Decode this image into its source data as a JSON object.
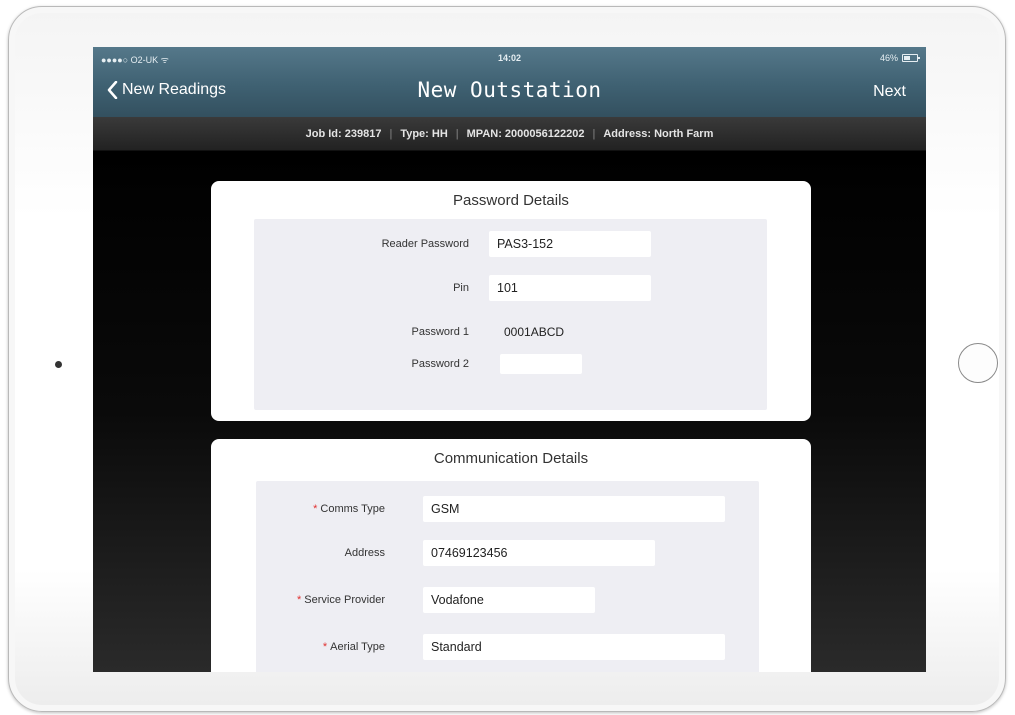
{
  "status_bar": {
    "carrier": "●●●●○ O2-UK ᯤ",
    "time": "14:02",
    "battery": "46%"
  },
  "nav": {
    "back_label": "New Readings",
    "title": "New Outstation",
    "next_label": "Next"
  },
  "job_info": {
    "job_id": "Job Id: 239817",
    "type": "Type: HH",
    "mpan": "MPAN: 2000056122202",
    "address": "Address: North Farm"
  },
  "password_details": {
    "title": "Password Details",
    "reader_password_label": "Reader Password",
    "reader_password_value": "PAS3-152",
    "pin_label": "Pin",
    "pin_value": "101",
    "password1_label": "Password 1",
    "password1_value": "0001ABCD",
    "password2_label": "Password 2",
    "password2_value": ""
  },
  "communication_details": {
    "title": "Communication Details",
    "required_marker": "*",
    "comms_type_label": "Comms Type",
    "comms_type_value": "GSM",
    "address_label": "Address",
    "address_value": "07469123456",
    "service_provider_label": "Service Provider",
    "service_provider_value": "Vodafone",
    "aerial_type_label": "Aerial Type",
    "aerial_type_value": "Standard"
  },
  "colors": {
    "nav_bar": "#3f6172",
    "required": "#e03030",
    "form_background": "#eeeef3"
  }
}
